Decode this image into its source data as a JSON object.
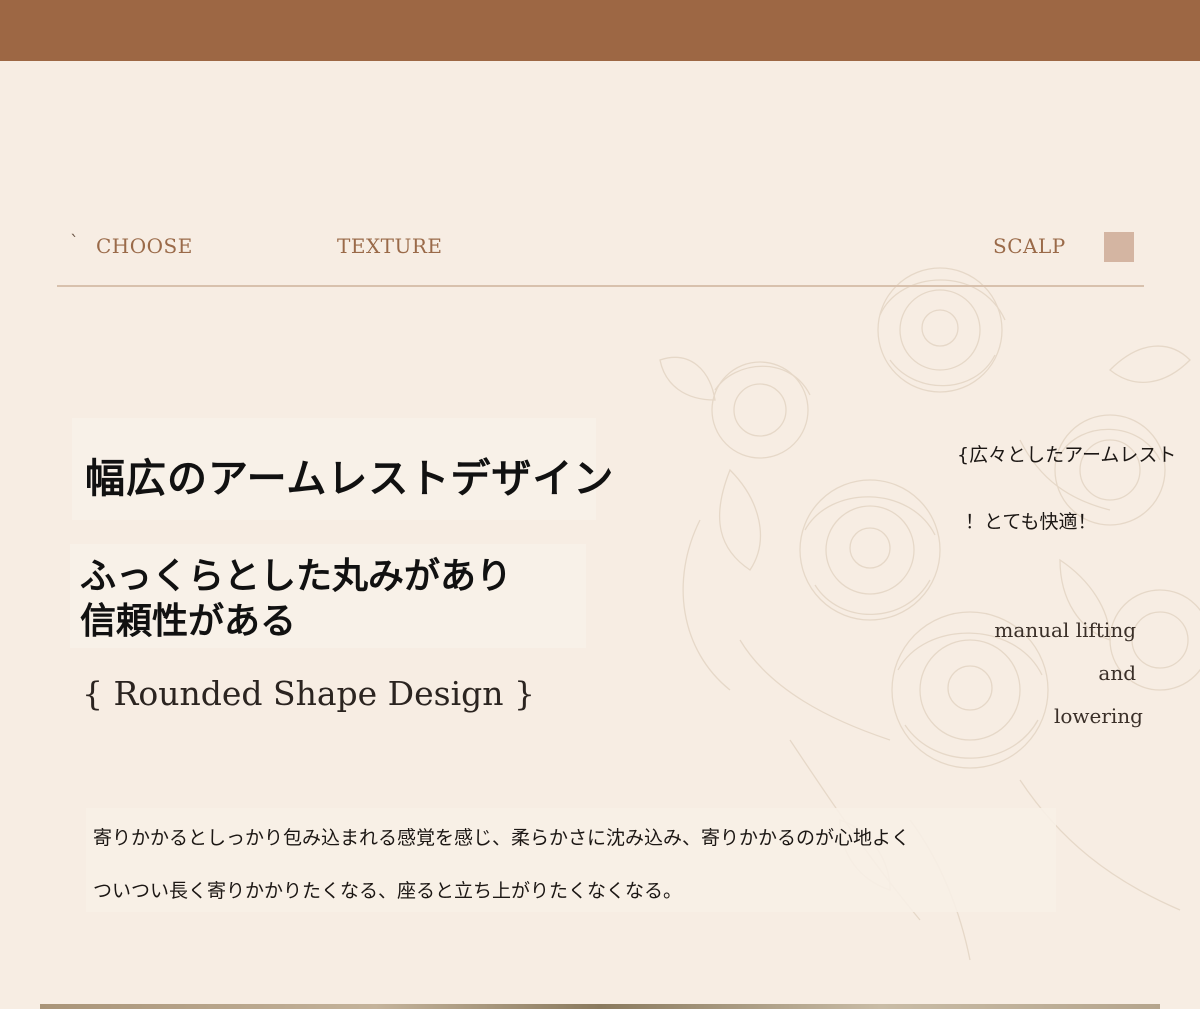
{
  "nav": {
    "tick": "`",
    "items": [
      {
        "label": "CHOOSE"
      },
      {
        "label": "TEXTURE"
      },
      {
        "label": "SCALP"
      }
    ]
  },
  "hero": {
    "title": "幅広のアームレストデザイン",
    "subtitle_line1": "ふっくらとした丸みがあり",
    "subtitle_line2": "信頼性がある",
    "english_title": "{ Rounded Shape Design }"
  },
  "side": {
    "note1": "{広々としたアームレスト",
    "note2": "！とても快適！",
    "en_line1": "manual lifting",
    "en_line2": "and",
    "en_line3": "lowering"
  },
  "body": {
    "line1": "寄りかかるとしっかり包み込まれる感覚を感じ、柔らかさに沈み込み、寄りかかるのが心地よく",
    "line2": "ついつい長く寄りかかりたくなる、座ると立ち上がりたくなくなる。"
  },
  "colors": {
    "header": "#9d6744",
    "background": "#f7ede3",
    "accent_text": "#9a6a49",
    "square": "#d4b5a2"
  }
}
